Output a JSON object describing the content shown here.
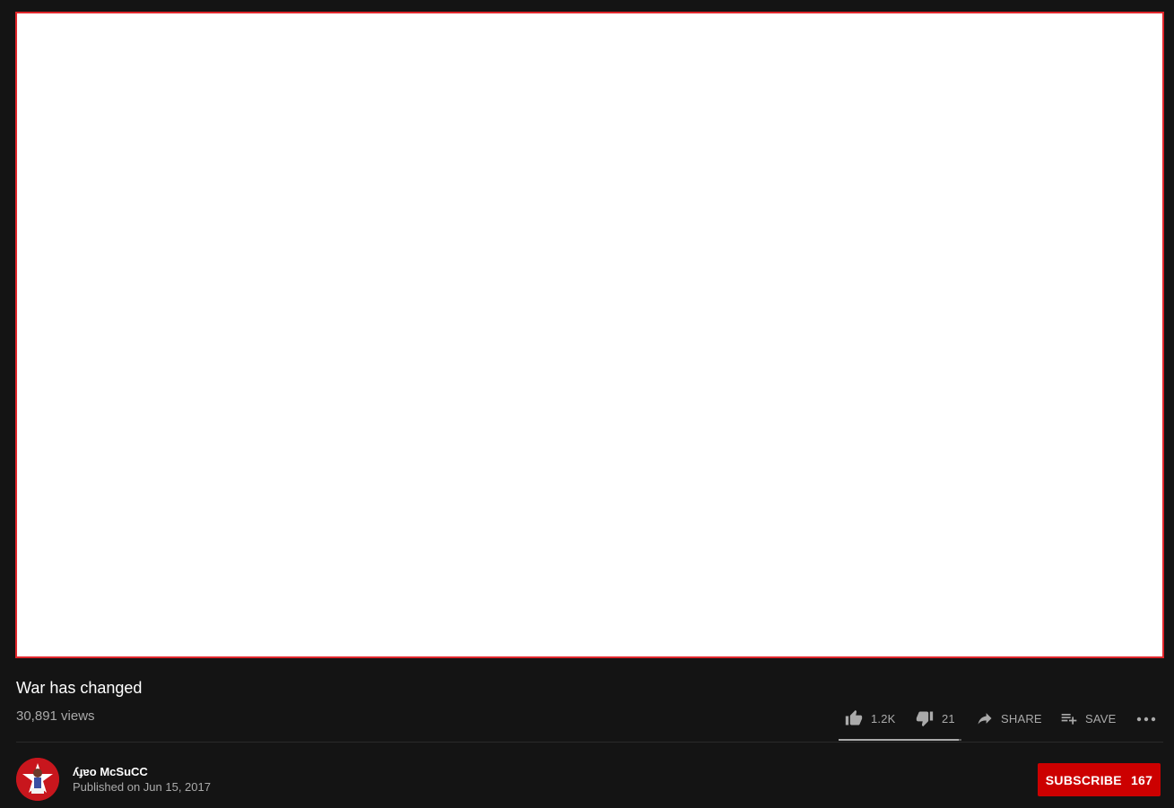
{
  "video": {
    "title": "War has changed",
    "views": "30,891 views"
  },
  "actions": {
    "likes": "1.2K",
    "dislikes": "21",
    "share_label": "SHARE",
    "save_label": "SAVE",
    "like_ratio": 0.98
  },
  "channel": {
    "name": "ʎɟɐo McSuCC",
    "published": "Published on Jun 15, 2017"
  },
  "subscribe": {
    "label": "SUBSCRIBE",
    "count": "167"
  },
  "colors": {
    "background": "#141414",
    "accent": "#cc0000",
    "player_border": "#e0262b",
    "muted_text": "#aaaaaa"
  }
}
